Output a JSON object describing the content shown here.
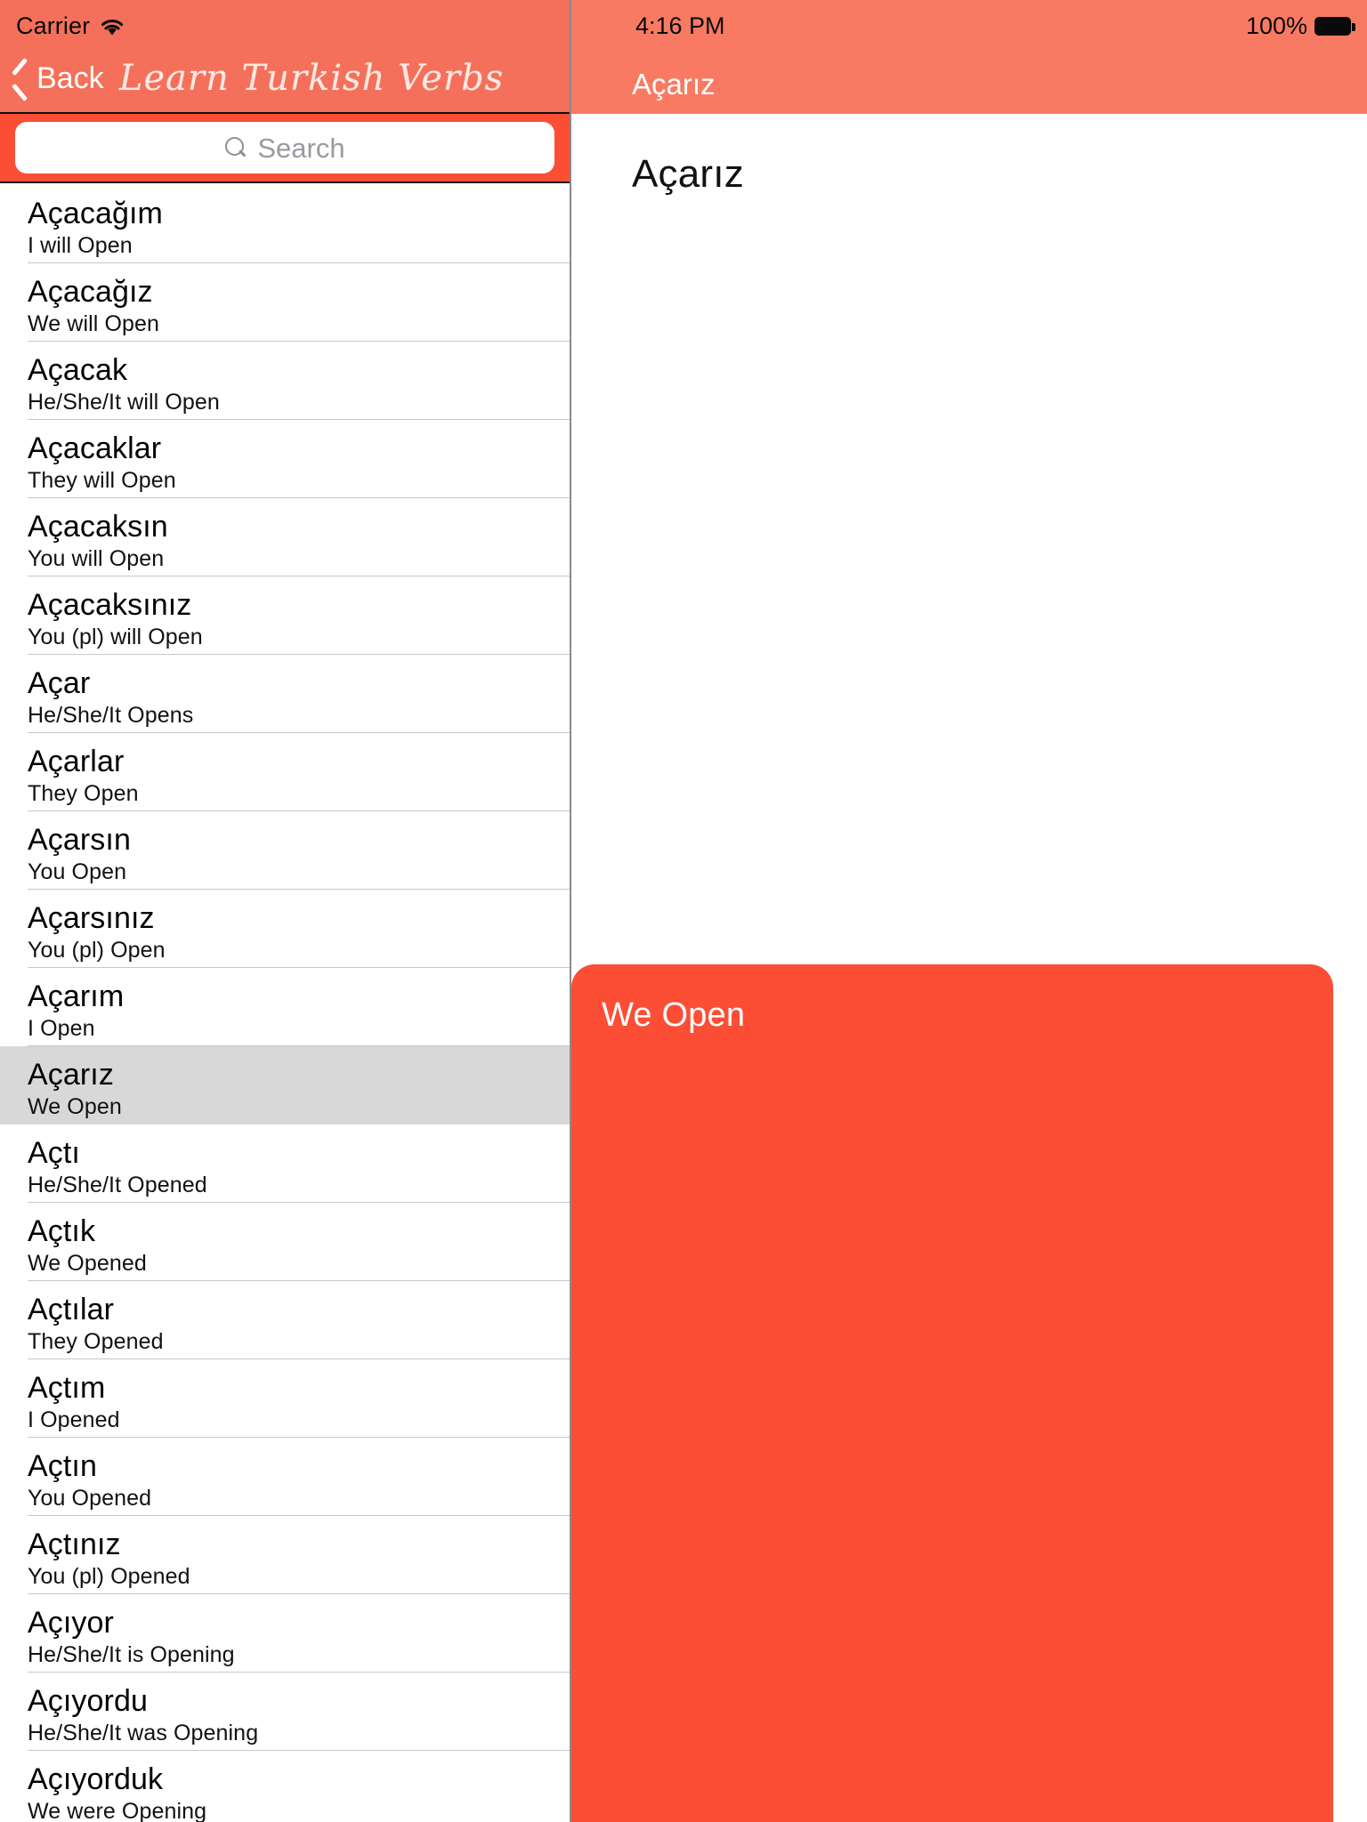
{
  "status_bar": {
    "carrier": "Carrier",
    "wifi_icon": "wifi-icon",
    "time": "4:16 PM",
    "battery_percent": "100%",
    "battery_icon": "battery-full-icon"
  },
  "master": {
    "back_label": "Back",
    "back_icon": "chevron-left-icon",
    "app_title": "Learn Turkish Verbs",
    "search": {
      "placeholder": "Search",
      "value": "",
      "icon": "search-icon"
    },
    "selected_index": 11,
    "rows": [
      {
        "verb": "Açacağım",
        "meaning": "I will Open"
      },
      {
        "verb": "Açacağız",
        "meaning": "We will Open"
      },
      {
        "verb": "Açacak",
        "meaning": "He/She/It will Open"
      },
      {
        "verb": "Açacaklar",
        "meaning": "They will Open"
      },
      {
        "verb": "Açacaksın",
        "meaning": "You will Open"
      },
      {
        "verb": "Açacaksınız",
        "meaning": "You (pl) will Open"
      },
      {
        "verb": "Açar",
        "meaning": "He/She/It Opens"
      },
      {
        "verb": "Açarlar",
        "meaning": "They Open"
      },
      {
        "verb": "Açarsın",
        "meaning": "You Open"
      },
      {
        "verb": "Açarsınız",
        "meaning": "You (pl) Open"
      },
      {
        "verb": "Açarım",
        "meaning": "I Open"
      },
      {
        "verb": "Açarız",
        "meaning": "We Open"
      },
      {
        "verb": "Açtı",
        "meaning": "He/She/It Opened"
      },
      {
        "verb": "Açtık",
        "meaning": "We Opened"
      },
      {
        "verb": "Açtılar",
        "meaning": "They Opened"
      },
      {
        "verb": "Açtım",
        "meaning": "I Opened"
      },
      {
        "verb": "Açtın",
        "meaning": "You Opened"
      },
      {
        "verb": "Açtınız",
        "meaning": "You (pl) Opened"
      },
      {
        "verb": "Açıyor",
        "meaning": "He/She/It is Opening"
      },
      {
        "verb": "Açıyordu",
        "meaning": "He/She/It was Opening"
      },
      {
        "verb": "Açıyorduk",
        "meaning": "We were Opening"
      }
    ]
  },
  "detail": {
    "nav_title": "Açarız",
    "heading": "Açarız",
    "meaning": "We Open"
  },
  "colors": {
    "nav_coral": "#f4705a",
    "accent_red": "#fc4e35",
    "selected_row_gray": "#d8d8d8",
    "separator": "#c8c7cc"
  }
}
